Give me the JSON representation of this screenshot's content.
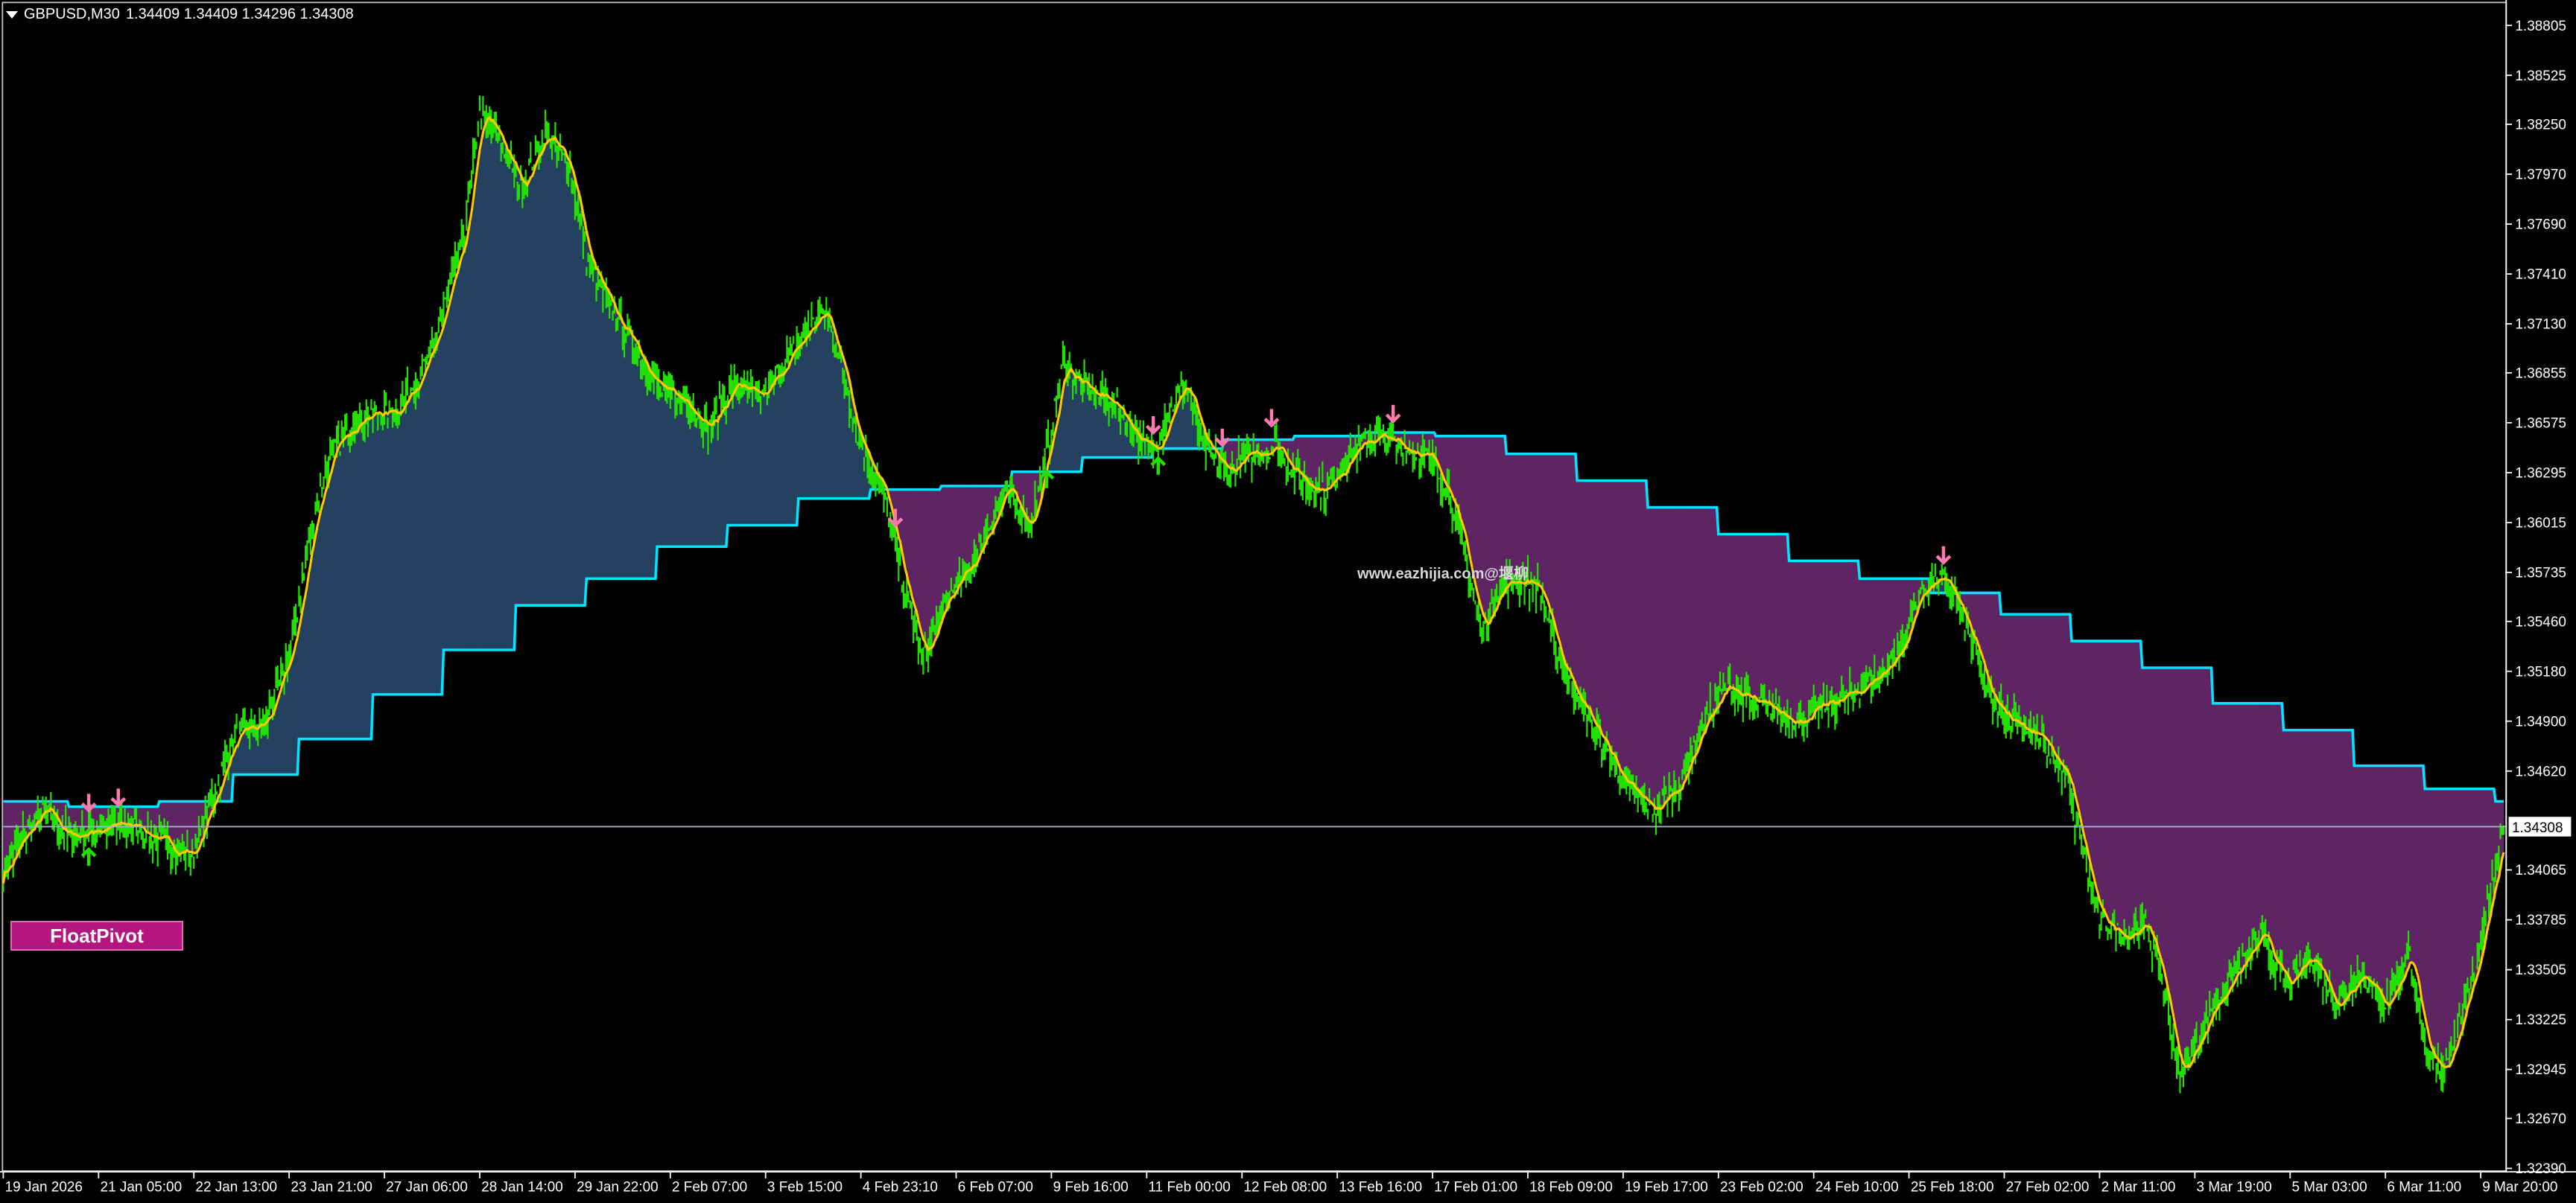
{
  "header": {
    "symbol": "GBPUSD,M30",
    "ohlc": "1.34409 1.34409 1.34296 1.34308"
  },
  "indicator_label": "FloatPivot",
  "watermark": "www.eazhijia.com@堰柳",
  "colors": {
    "background": "#000000",
    "price": "#22e000",
    "ma": "#ffc800",
    "pivot": "#00e4ff",
    "fill_bull": "#24415f",
    "fill_bear": "#5f2463",
    "arrow": "#ff78b0",
    "axis": "#ffffff"
  },
  "chart_data": {
    "type": "line",
    "title": "GBPUSD,M30",
    "current_price": 1.34308,
    "ylim": [
      1.3225,
      1.3896
    ],
    "y_ticks": [
      "1.38805",
      "1.38525",
      "1.38250",
      "1.37970",
      "1.37690",
      "1.37410",
      "1.37130",
      "1.36855",
      "1.36575",
      "1.36295",
      "1.36015",
      "1.35735",
      "1.35460",
      "1.35180",
      "1.34900",
      "1.34620",
      "1.34065",
      "1.33785",
      "1.33505",
      "1.33225",
      "1.32945",
      "1.32670",
      "1.32390"
    ],
    "x_ticks": [
      "19 Jan 2026",
      "21 Jan 05:00",
      "22 Jan 13:00",
      "23 Jan 21:00",
      "27 Jan 06:00",
      "28 Jan 14:00",
      "29 Jan 22:00",
      "2 Feb 07:00",
      "3 Feb 15:00",
      "4 Feb 23:10",
      "6 Feb 07:00",
      "9 Feb 16:00",
      "11 Feb 00:00",
      "12 Feb 08:00",
      "13 Feb 16:00",
      "17 Feb 01:00",
      "18 Feb 09:00",
      "19 Feb 17:00",
      "23 Feb 02:00",
      "24 Feb 10:00",
      "25 Feb 18:00",
      "27 Feb 02:00",
      "2 Mar 11:00",
      "3 Mar 19:00",
      "5 Mar 03:00",
      "6 Mar 11:00",
      "9 Mar 20:00"
    ],
    "price_anchors": [
      [
        0,
        1.3405
      ],
      [
        12,
        1.3425
      ],
      [
        25,
        1.344
      ],
      [
        40,
        1.3425
      ],
      [
        60,
        1.343
      ],
      [
        80,
        1.3432
      ],
      [
        100,
        1.342
      ],
      [
        115,
        1.3415
      ],
      [
        125,
        1.344
      ],
      [
        140,
        1.348
      ],
      [
        160,
        1.349
      ],
      [
        175,
        1.353
      ],
      [
        190,
        1.361
      ],
      [
        200,
        1.364
      ],
      [
        215,
        1.366
      ],
      [
        240,
        1.3665
      ],
      [
        260,
        1.3695
      ],
      [
        280,
        1.376
      ],
      [
        290,
        1.383
      ],
      [
        300,
        1.382
      ],
      [
        315,
        1.379
      ],
      [
        330,
        1.382
      ],
      [
        345,
        1.38
      ],
      [
        355,
        1.375
      ],
      [
        370,
        1.372
      ],
      [
        385,
        1.37
      ],
      [
        400,
        1.3675
      ],
      [
        415,
        1.367
      ],
      [
        430,
        1.3655
      ],
      [
        445,
        1.368
      ],
      [
        460,
        1.367
      ],
      [
        475,
        1.369
      ],
      [
        490,
        1.371
      ],
      [
        500,
        1.372
      ],
      [
        510,
        1.369
      ],
      [
        520,
        1.365
      ],
      [
        535,
        1.362
      ],
      [
        550,
        1.356
      ],
      [
        560,
        1.3525
      ],
      [
        575,
        1.356
      ],
      [
        590,
        1.358
      ],
      [
        600,
        1.36
      ],
      [
        610,
        1.362
      ],
      [
        625,
        1.36
      ],
      [
        635,
        1.364
      ],
      [
        645,
        1.369
      ],
      [
        660,
        1.3675
      ],
      [
        675,
        1.367
      ],
      [
        690,
        1.365
      ],
      [
        700,
        1.364
      ],
      [
        710,
        1.3665
      ],
      [
        720,
        1.368
      ],
      [
        730,
        1.3645
      ],
      [
        745,
        1.363
      ],
      [
        760,
        1.364
      ],
      [
        775,
        1.3645
      ],
      [
        790,
        1.3625
      ],
      [
        805,
        1.362
      ],
      [
        820,
        1.364
      ],
      [
        835,
        1.365
      ],
      [
        850,
        1.3645
      ],
      [
        865,
        1.364
      ],
      [
        880,
        1.362
      ],
      [
        890,
        1.358
      ],
      [
        900,
        1.354
      ],
      [
        910,
        1.3565
      ],
      [
        925,
        1.357
      ],
      [
        935,
        1.3565
      ],
      [
        945,
        1.353
      ],
      [
        960,
        1.35
      ],
      [
        975,
        1.3475
      ],
      [
        990,
        1.345
      ],
      [
        1005,
        1.344
      ],
      [
        1020,
        1.3455
      ],
      [
        1035,
        1.349
      ],
      [
        1050,
        1.351
      ],
      [
        1065,
        1.35
      ],
      [
        1080,
        1.3495
      ],
      [
        1095,
        1.349
      ],
      [
        1110,
        1.35
      ],
      [
        1125,
        1.3505
      ],
      [
        1140,
        1.3515
      ],
      [
        1155,
        1.353
      ],
      [
        1165,
        1.356
      ],
      [
        1175,
        1.357
      ],
      [
        1185,
        1.3565
      ],
      [
        1200,
        1.353
      ],
      [
        1210,
        1.35
      ],
      [
        1225,
        1.349
      ],
      [
        1240,
        1.348
      ],
      [
        1255,
        1.346
      ],
      [
        1265,
        1.342
      ],
      [
        1275,
        1.338
      ],
      [
        1290,
        1.337
      ],
      [
        1305,
        1.3375
      ],
      [
        1315,
        1.334
      ],
      [
        1325,
        1.329
      ],
      [
        1335,
        1.331
      ],
      [
        1345,
        1.333
      ],
      [
        1360,
        1.335
      ],
      [
        1375,
        1.337
      ],
      [
        1390,
        1.334
      ],
      [
        1405,
        1.336
      ],
      [
        1420,
        1.333
      ],
      [
        1435,
        1.335
      ],
      [
        1450,
        1.333
      ],
      [
        1465,
        1.336
      ],
      [
        1475,
        1.33
      ],
      [
        1485,
        1.3295
      ],
      [
        1495,
        1.332
      ],
      [
        1505,
        1.3355
      ],
      [
        1515,
        1.34
      ],
      [
        1522,
        1.3431
      ]
    ],
    "pivot_steps": [
      [
        0,
        1.3445
      ],
      [
        40,
        1.3442
      ],
      [
        95,
        1.3445
      ],
      [
        140,
        1.346
      ],
      [
        180,
        1.348
      ],
      [
        225,
        1.3505
      ],
      [
        268,
        1.353
      ],
      [
        312,
        1.3555
      ],
      [
        355,
        1.357
      ],
      [
        398,
        1.3588
      ],
      [
        441,
        1.36
      ],
      [
        484,
        1.3615
      ],
      [
        528,
        1.362
      ],
      [
        571,
        1.3622
      ],
      [
        614,
        1.363
      ],
      [
        657,
        1.3638
      ],
      [
        700,
        1.3643
      ],
      [
        743,
        1.3648
      ],
      [
        786,
        1.365
      ],
      [
        829,
        1.3652
      ],
      [
        872,
        1.365
      ],
      [
        915,
        1.364
      ],
      [
        958,
        1.3625
      ],
      [
        1001,
        1.361
      ],
      [
        1044,
        1.3595
      ],
      [
        1087,
        1.358
      ],
      [
        1130,
        1.357
      ],
      [
        1173,
        1.3562
      ],
      [
        1216,
        1.355
      ],
      [
        1259,
        1.3535
      ],
      [
        1302,
        1.352
      ],
      [
        1345,
        1.35
      ],
      [
        1388,
        1.3485
      ],
      [
        1431,
        1.3465
      ],
      [
        1474,
        1.3452
      ],
      [
        1517,
        1.3445
      ]
    ],
    "arrow_signals": [
      {
        "bar": 52,
        "dir": "down"
      },
      {
        "bar": 70,
        "dir": "down"
      },
      {
        "bar": 52,
        "dir": "up"
      },
      {
        "bar": 543,
        "dir": "down"
      },
      {
        "bar": 635,
        "dir": "up"
      },
      {
        "bar": 700,
        "dir": "down"
      },
      {
        "bar": 703,
        "dir": "up"
      },
      {
        "bar": 742,
        "dir": "down"
      },
      {
        "bar": 772,
        "dir": "down"
      },
      {
        "bar": 846,
        "dir": "down"
      },
      {
        "bar": 1181,
        "dir": "down"
      }
    ]
  }
}
